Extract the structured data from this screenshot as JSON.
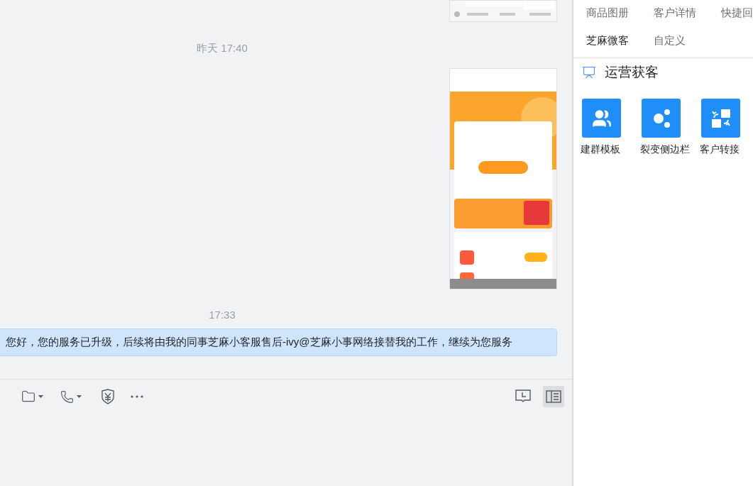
{
  "chat": {
    "messages": [
      {
        "kind": "picture"
      },
      {
        "kind": "time",
        "text": "昨天 17:40"
      },
      {
        "kind": "picture"
      },
      {
        "kind": "time",
        "text": "17:33"
      },
      {
        "kind": "text",
        "text": "您好，您的服务已升级，后续将由我的同事芝麻小客服售后-ivy@芝麻小事网络接替我的工作，继续为您服务"
      }
    ]
  },
  "composer_toolbar": {
    "panel_toggle": {
      "on": true
    }
  },
  "side_panel": {
    "tab_rows": [
      [
        {
          "label": "商品图册",
          "selected": false
        },
        {
          "label": "客户详情",
          "selected": false
        },
        {
          "label": "快捷回",
          "selected": false
        }
      ],
      [
        {
          "label": "芝麻微客",
          "selected": true
        },
        {
          "label": "自定义",
          "selected": false
        }
      ]
    ],
    "section": {
      "title": "运营获客",
      "tools": [
        {
          "label": "建群模板"
        },
        {
          "label": "裂变侧边栏"
        },
        {
          "label": "客户转接"
        }
      ]
    }
  }
}
